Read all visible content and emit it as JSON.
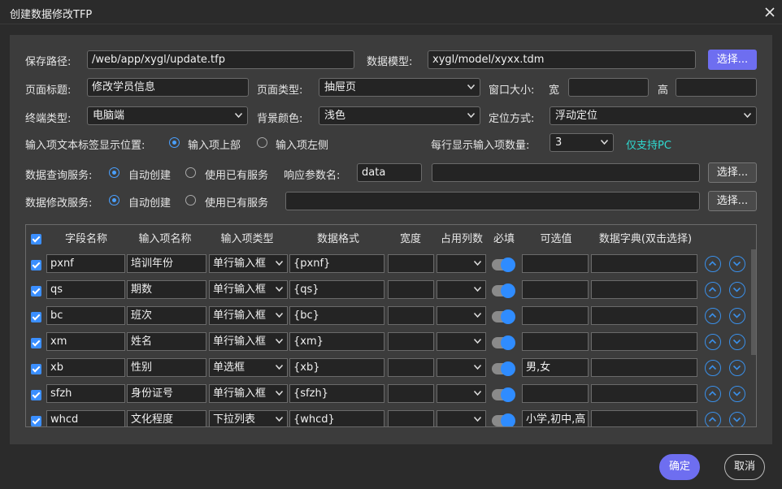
{
  "window": {
    "title": "创建数据修改TFP"
  },
  "form": {
    "save_path_label": "保存路径:",
    "save_path_value": "/web/app/xygl/update.tfp",
    "data_model_label": "数据模型:",
    "data_model_value": "xygl/model/xyxx.tdm",
    "choose_label": "选择...",
    "page_title_label": "页面标题:",
    "page_title_value": "修改学员信息",
    "page_type_label": "页面类型:",
    "page_type_value": "抽屉页",
    "window_size_label": "窗口大小:",
    "width_label": "宽",
    "width_value": "",
    "height_label": "高",
    "height_value": "",
    "terminal_label": "终端类型:",
    "terminal_value": "电脑端",
    "bg_color_label": "背景颜色:",
    "bg_color_value": "浅色",
    "position_label": "定位方式:",
    "position_value": "浮动定位",
    "label_pos_label": "输入项文本标签显示位置:",
    "label_pos_opt1": "输入项上部",
    "label_pos_opt2": "输入项左侧",
    "per_row_label": "每行显示输入项数量:",
    "per_row_value": "3",
    "pc_only_note": "仅支持PC",
    "query_service_label": "数据查询服务:",
    "auto_create": "自动创建",
    "use_existing": "使用已有服务",
    "resp_param_label": "响应参数名:",
    "resp_param_value": "data",
    "query_service_value": "",
    "modify_service_label": "数据修改服务:",
    "modify_service_value": ""
  },
  "table": {
    "headers": [
      "字段名称",
      "输入项名称",
      "输入项类型",
      "数据格式",
      "宽度",
      "占用列数",
      "必填",
      "可选值",
      "数据字典(双击选择)"
    ],
    "rows": [
      {
        "field": "pxnf",
        "name": "培训年份",
        "type": "单行输入框",
        "format": "{pxnf}",
        "width": "",
        "cols": "",
        "options": "",
        "dict": ""
      },
      {
        "field": "qs",
        "name": "期数",
        "type": "单行输入框",
        "format": "{qs}",
        "width": "",
        "cols": "",
        "options": "",
        "dict": ""
      },
      {
        "field": "bc",
        "name": "班次",
        "type": "单行输入框",
        "format": "{bc}",
        "width": "",
        "cols": "",
        "options": "",
        "dict": ""
      },
      {
        "field": "xm",
        "name": "姓名",
        "type": "单行输入框",
        "format": "{xm}",
        "width": "",
        "cols": "",
        "options": "",
        "dict": ""
      },
      {
        "field": "xb",
        "name": "性别",
        "type": "单选框",
        "format": "{xb}",
        "width": "",
        "cols": "",
        "options": "男,女",
        "dict": ""
      },
      {
        "field": "sfzh",
        "name": "身份证号",
        "type": "单行输入框",
        "format": "{sfzh}",
        "width": "",
        "cols": "",
        "options": "",
        "dict": ""
      },
      {
        "field": "whcd",
        "name": "文化程度",
        "type": "下拉列表",
        "format": "{whcd}",
        "width": "",
        "cols": "",
        "options": "小学,初中,高",
        "dict": ""
      }
    ]
  },
  "footer": {
    "ok_label": "确定",
    "cancel_label": "取消"
  },
  "colors": {
    "accent": "#6e6ef0",
    "toggle_on": "#2f8cff",
    "note": "#2fd9d0"
  }
}
